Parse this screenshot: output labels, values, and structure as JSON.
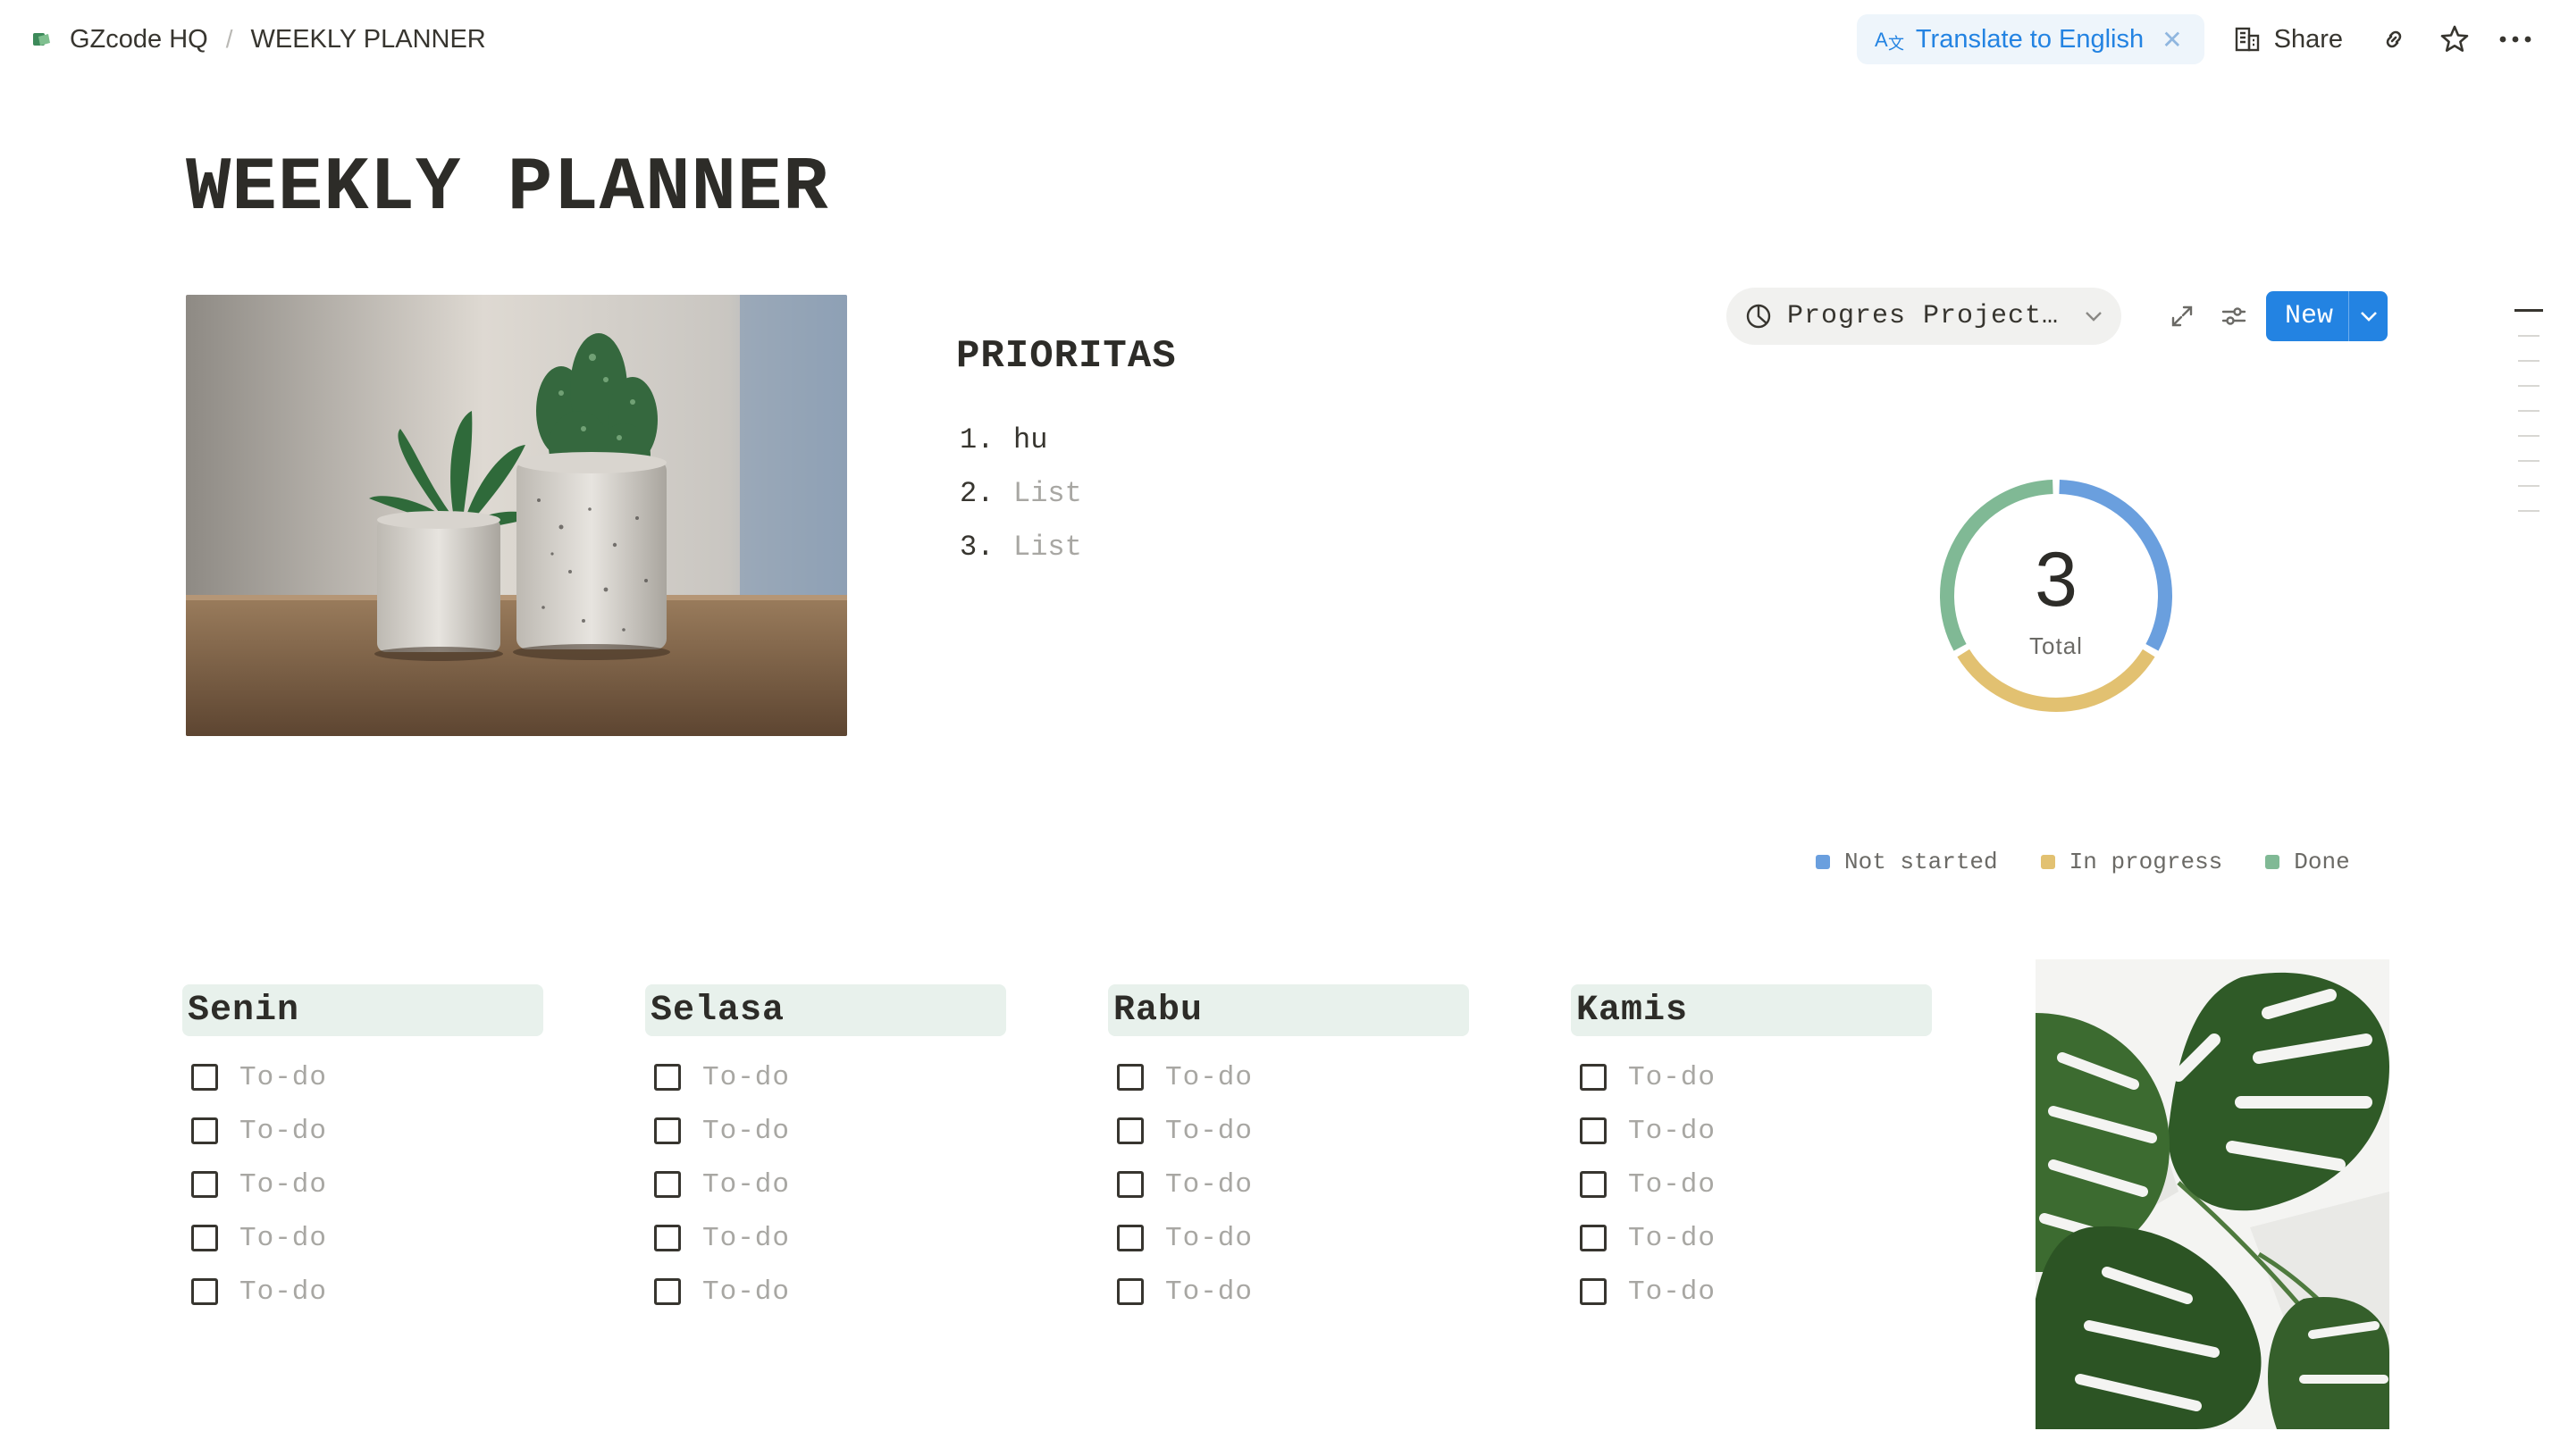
{
  "topbar": {
    "workspace": "GZcode HQ",
    "separator": "/",
    "page": "WEEKLY PLANNER",
    "translate_label": "Translate to English",
    "share_label": "Share",
    "icons": [
      "translate-icon",
      "close-icon",
      "building-icon",
      "link-icon",
      "star-icon",
      "more-icon"
    ]
  },
  "page": {
    "title": "WEEKLY PLANNER"
  },
  "prioritas": {
    "heading": "PRIORITAS",
    "items": [
      {
        "num": "1.",
        "text": "hu",
        "placeholder": false
      },
      {
        "num": "2.",
        "text": "List",
        "placeholder": true
      },
      {
        "num": "3.",
        "text": "List",
        "placeholder": true
      }
    ]
  },
  "chart_view": {
    "view_name": "Progres Project…",
    "new_label": "New",
    "colors": {
      "accent": "#2383e2"
    }
  },
  "chart_data": {
    "type": "pie",
    "donut": true,
    "total_value": "3",
    "total_label": "Total",
    "categories": [
      "Not started",
      "In progress",
      "Done"
    ],
    "values": [
      1,
      1,
      1
    ],
    "colors": [
      "#6a9fde",
      "#e2c171",
      "#80b995"
    ],
    "legend_position": "bottom-right"
  },
  "days": [
    {
      "name": "Senin",
      "todos": [
        "To-do",
        "To-do",
        "To-do",
        "To-do",
        "To-do"
      ]
    },
    {
      "name": "Selasa",
      "todos": [
        "To-do",
        "To-do",
        "To-do",
        "To-do",
        "To-do"
      ]
    },
    {
      "name": "Rabu",
      "todos": [
        "To-do",
        "To-do",
        "To-do",
        "To-do",
        "To-do"
      ]
    },
    {
      "name": "Kamis",
      "todos": [
        "To-do",
        "To-do",
        "To-do",
        "To-do",
        "To-do"
      ]
    }
  ],
  "images": {
    "cactus": "photo of potted cacti",
    "leaf": "photo of monstera leaves"
  }
}
